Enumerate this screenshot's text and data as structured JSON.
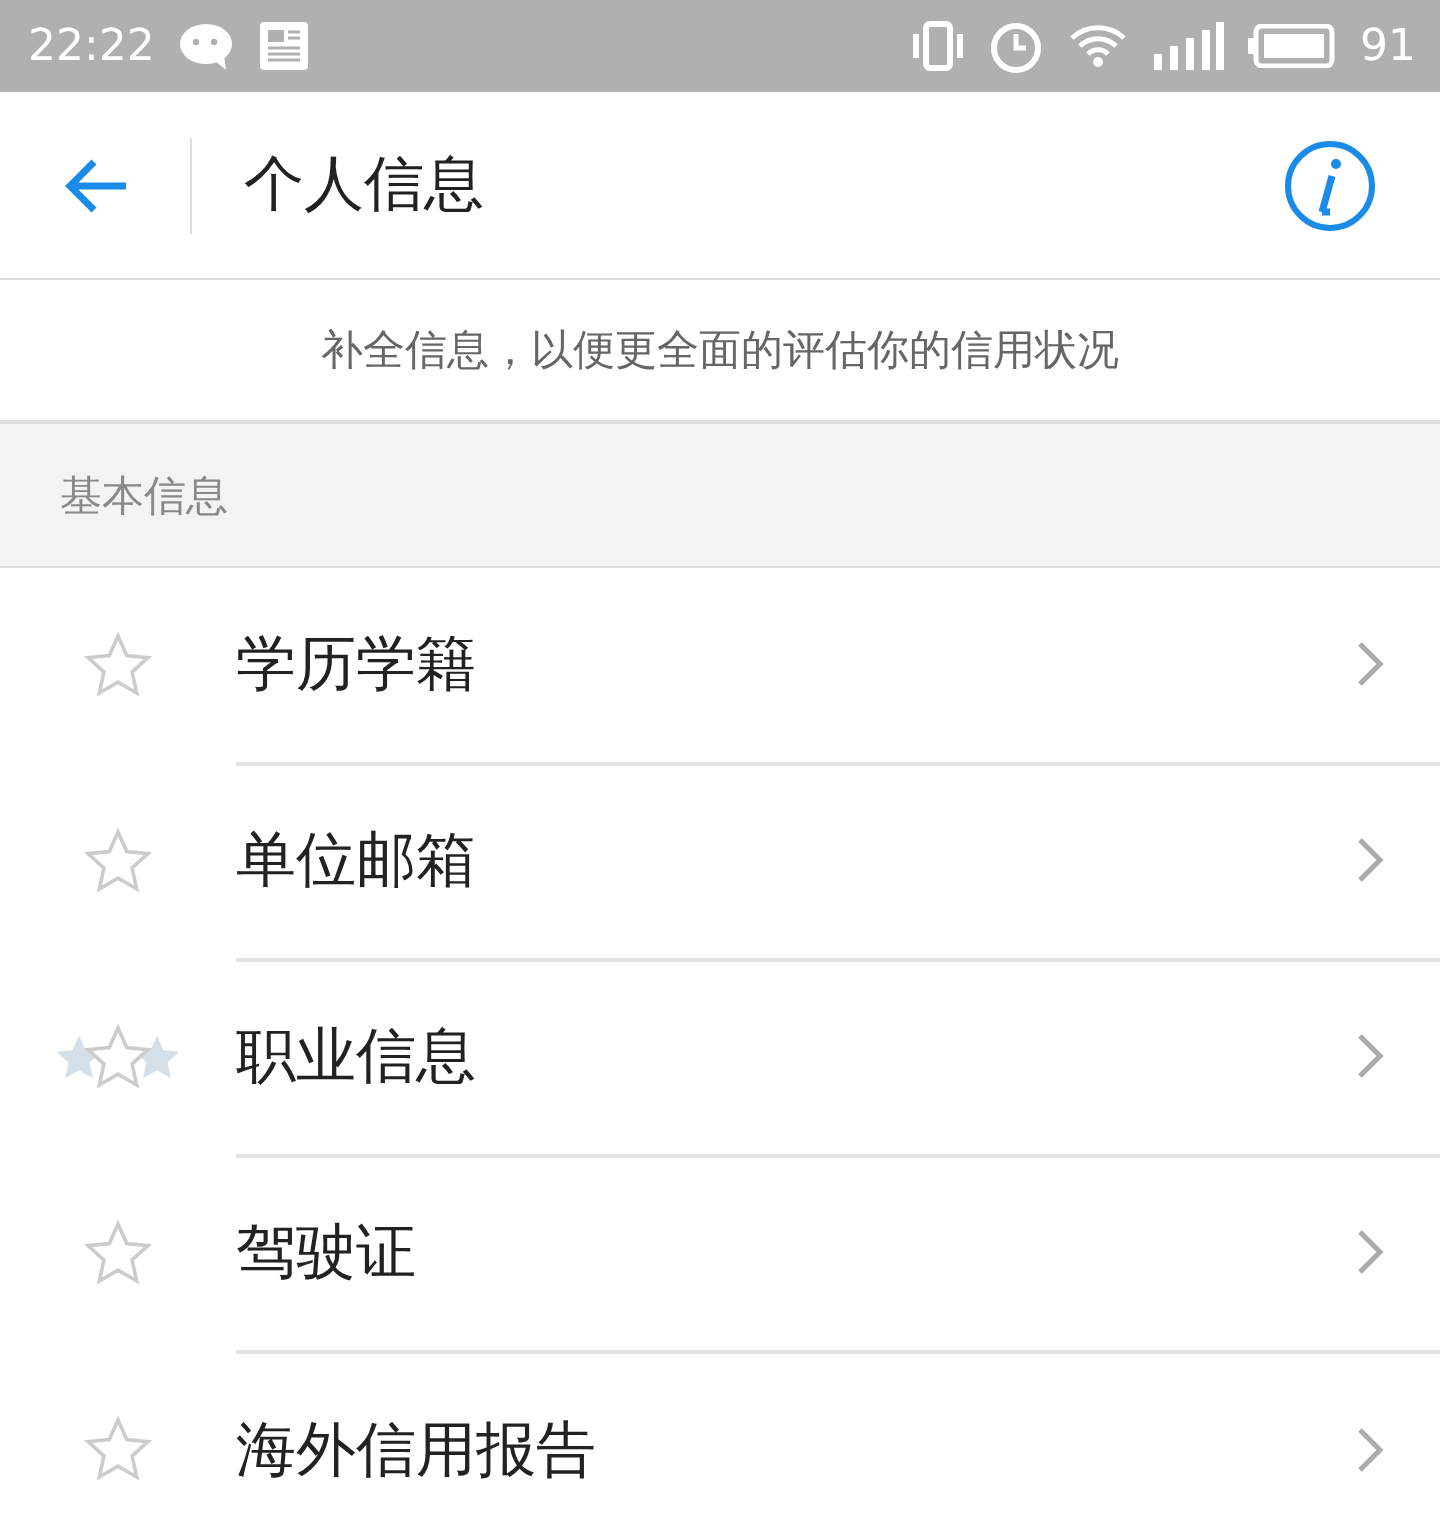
{
  "status_bar": {
    "time": "22:22",
    "battery": "91"
  },
  "header": {
    "title": "个人信息"
  },
  "notice": "补全信息，以便更全面的评估你的信用状况",
  "section": {
    "title": "基本信息",
    "items": [
      {
        "label": "学历学籍",
        "kind": "plain"
      },
      {
        "label": "单位邮箱",
        "kind": "plain"
      },
      {
        "label": "职业信息",
        "kind": "cluster"
      },
      {
        "label": "驾驶证",
        "kind": "plain"
      },
      {
        "label": "海外信用报告",
        "kind": "plain"
      }
    ]
  }
}
